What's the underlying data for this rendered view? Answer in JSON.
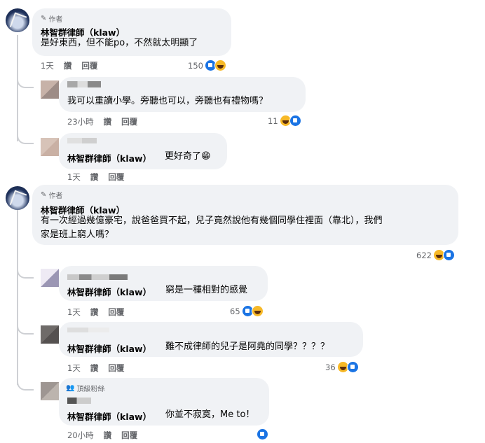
{
  "comments": [
    {
      "author_badge": "作者",
      "name": "林智群律師（klaw）",
      "text": "是好東西，但不能po，不然就太明顯了",
      "time": "1天",
      "like_label": "讚",
      "reply_label": "回覆",
      "reactions": "150"
    },
    {
      "text": "我可以重讀小學。旁聽也可以，旁聽也有禮物嗎？",
      "time": "23小時",
      "like_label": "讚",
      "reply_label": "回覆",
      "reactions": "11"
    },
    {
      "name": "林智群律師（klaw）",
      "text": "更好奇了",
      "emoji": "😁",
      "time": "1天",
      "like_label": "讚",
      "reply_label": "回覆"
    },
    {
      "author_badge": "作者",
      "name": "林智群律師（klaw）",
      "text_line1": "有一次經過幾億豪宅，說爸爸買不起，兒子竟然說他有幾個同學住裡面（靠北），我們",
      "text_line2": "家是班上窮人嗎？",
      "reactions": "622"
    },
    {
      "name": "林智群律師（klaw）",
      "text": "窮是一種相對的感覺",
      "time": "1天",
      "like_label": "讚",
      "reply_label": "回覆",
      "reactions": "65"
    },
    {
      "name": "林智群律師（klaw）",
      "text": "難不成律師的兒子是阿堯的同學？？？？",
      "time": "1天",
      "like_label": "讚",
      "reply_label": "回覆",
      "reactions": "36"
    },
    {
      "badge": "頂級粉絲",
      "name": "林智群律師（klaw）",
      "text": "你並不寂寞，Me to！",
      "time": "20小時",
      "like_label": "讚",
      "reply_label": "回覆"
    }
  ],
  "colors": {
    "like": "#1b74e4",
    "haha": "#f7b928",
    "bubble": "#f0f2f5",
    "meta": "#65676b"
  }
}
